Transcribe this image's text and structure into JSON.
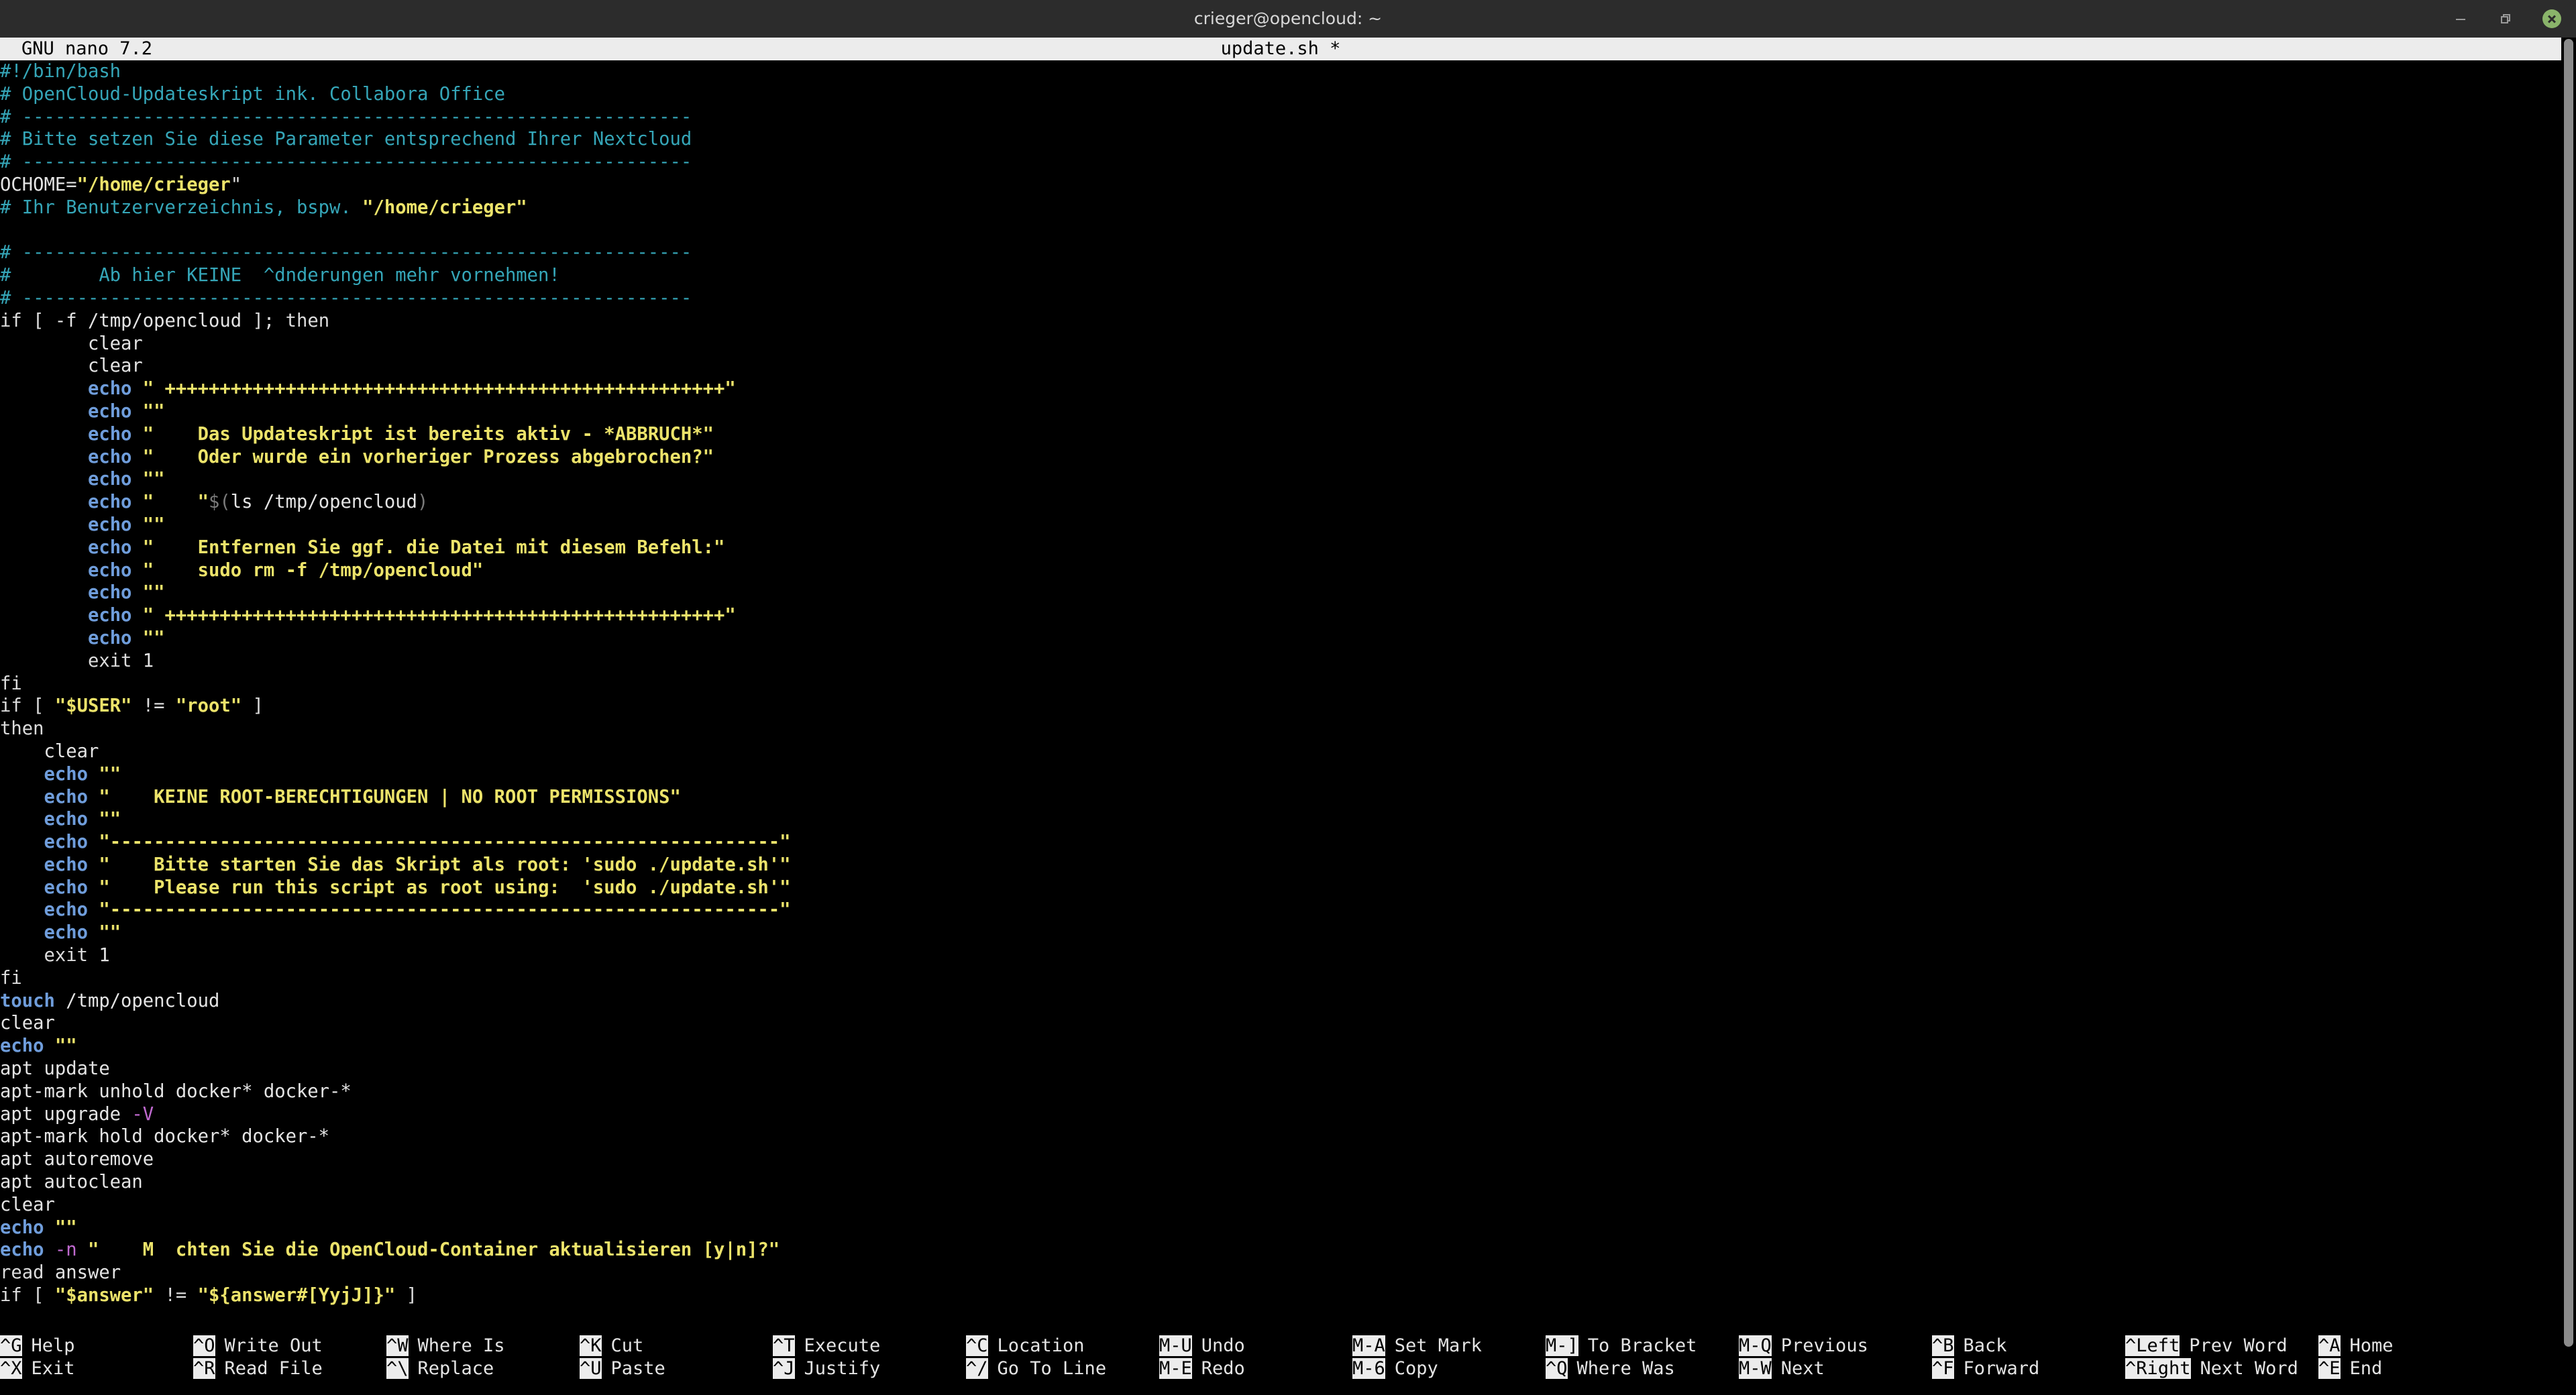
{
  "window": {
    "title": "crieger@opencloud: ~"
  },
  "nano": {
    "version": "GNU nano 7.2",
    "filename": "update.sh *"
  },
  "colors": {
    "header_bg": "#ececec",
    "comment": "#35a6b8",
    "string": "#ece36a",
    "keyword": "#3fa247",
    "command": "#6f9ddb",
    "flag": "#c06ad0",
    "trailing_whitespace": "#4e9a06",
    "close_button": "#8ab46a"
  },
  "lines": [
    [
      {
        "t": "#!/bin/bash",
        "c": "comment"
      }
    ],
    [
      {
        "t": "# OpenCloud-Updateskript ink. Collabora Office",
        "c": "comment"
      }
    ],
    [
      {
        "t": "# -------------------------------------------------------------",
        "c": "comment"
      }
    ],
    [
      {
        "t": "# Bitte setzen Sie diese Parameter entsprechend Ihrer Nextcloud",
        "c": "comment"
      }
    ],
    [
      {
        "t": "# -------------------------------------------------------------",
        "c": "comment"
      }
    ],
    [
      {
        "t": "OCHOME",
        "c": "plain"
      },
      {
        "t": "=",
        "c": "keyword"
      },
      {
        "t": "\"/home/crieger",
        "c": "str"
      },
      {
        "t": "\"",
        "c": "cursor"
      }
    ],
    [
      {
        "t": "# Ihr Benutzerverzeichnis, bspw. ",
        "c": "comment"
      },
      {
        "t": "\"/home/crieger\"",
        "c": "str"
      }
    ],
    [
      {
        "t": "",
        "c": "plain"
      }
    ],
    [
      {
        "t": "# -------------------------------------------------------------",
        "c": "comment"
      }
    ],
    [
      {
        "t": "#        Ab hier KEINE  ^dnderungen mehr vornehmen!",
        "c": "comment"
      }
    ],
    [
      {
        "t": "# -------------------------------------------------------------",
        "c": "comment"
      }
    ],
    [
      {
        "t": "if [ ",
        "c": "keyword"
      },
      {
        "t": "-f",
        "c": "plain"
      },
      {
        "t": " /tmp/opencloud ",
        "c": "plain"
      },
      {
        "t": "]; then",
        "c": "keyword"
      }
    ],
    [
      {
        "t": "        clear",
        "c": "plain"
      }
    ],
    [
      {
        "t": "        clear",
        "c": "plain"
      }
    ],
    [
      {
        "t": "        ",
        "c": "plain"
      },
      {
        "t": "echo",
        "c": "cmd"
      },
      {
        "t": " \" +++++++++++++++++++++++++++++++++++++++++++++++++++\"",
        "c": "str"
      }
    ],
    [
      {
        "t": "        ",
        "c": "plain"
      },
      {
        "t": "echo",
        "c": "cmd"
      },
      {
        "t": " \"\"",
        "c": "str"
      }
    ],
    [
      {
        "t": "        ",
        "c": "plain"
      },
      {
        "t": "echo",
        "c": "cmd"
      },
      {
        "t": " \"    Das Updateskript ist bereits aktiv - *ABBRUCH*\"",
        "c": "str"
      }
    ],
    [
      {
        "t": "        ",
        "c": "plain"
      },
      {
        "t": "echo",
        "c": "cmd"
      },
      {
        "t": " \"    Oder wurde ein vorheriger Prozess abgebrochen?\"",
        "c": "str"
      }
    ],
    [
      {
        "t": "        ",
        "c": "plain"
      },
      {
        "t": "echo",
        "c": "cmd"
      },
      {
        "t": " \"\"",
        "c": "str"
      }
    ],
    [
      {
        "t": "        ",
        "c": "plain"
      },
      {
        "t": "echo",
        "c": "cmd"
      },
      {
        "t": " \"    \"",
        "c": "str"
      },
      {
        "t": "$(",
        "c": "sub"
      },
      {
        "t": "ls /tmp/opencloud",
        "c": "plain"
      },
      {
        "t": ")",
        "c": "sub"
      }
    ],
    [
      {
        "t": "        ",
        "c": "plain"
      },
      {
        "t": "echo",
        "c": "cmd"
      },
      {
        "t": " \"\"",
        "c": "str"
      }
    ],
    [
      {
        "t": "        ",
        "c": "plain"
      },
      {
        "t": "echo",
        "c": "cmd"
      },
      {
        "t": " \"    Entfernen Sie ggf. die Datei mit diesem Befehl:\"",
        "c": "str"
      }
    ],
    [
      {
        "t": "        ",
        "c": "plain"
      },
      {
        "t": "echo",
        "c": "cmd"
      },
      {
        "t": " \"    sudo rm -f /tmp/opencloud\"",
        "c": "str"
      },
      {
        "t": "     ",
        "c": "trail"
      }
    ],
    [
      {
        "t": "        ",
        "c": "plain"
      },
      {
        "t": "echo",
        "c": "cmd"
      },
      {
        "t": " \"\"",
        "c": "str"
      }
    ],
    [
      {
        "t": "        ",
        "c": "plain"
      },
      {
        "t": "echo",
        "c": "cmd"
      },
      {
        "t": " \" +++++++++++++++++++++++++++++++++++++++++++++++++++\"",
        "c": "str"
      }
    ],
    [
      {
        "t": "        ",
        "c": "plain"
      },
      {
        "t": "echo",
        "c": "cmd"
      },
      {
        "t": " \"\"",
        "c": "str"
      }
    ],
    [
      {
        "t": "        ",
        "c": "plain"
      },
      {
        "t": "exit",
        "c": "keyword"
      },
      {
        "t": " 1",
        "c": "plain"
      }
    ],
    [
      {
        "t": "fi",
        "c": "keyword"
      }
    ],
    [
      {
        "t": "if [ ",
        "c": "keyword"
      },
      {
        "t": "\"$USER\"",
        "c": "str"
      },
      {
        "t": " != ",
        "c": "keyword"
      },
      {
        "t": "\"root\"",
        "c": "str"
      },
      {
        "t": " ]",
        "c": "keyword"
      }
    ],
    [
      {
        "t": "then",
        "c": "keyword"
      }
    ],
    [
      {
        "t": "    clear",
        "c": "plain"
      }
    ],
    [
      {
        "t": "    ",
        "c": "plain"
      },
      {
        "t": "echo",
        "c": "cmd"
      },
      {
        "t": " \"\"",
        "c": "str"
      }
    ],
    [
      {
        "t": "    ",
        "c": "plain"
      },
      {
        "t": "echo",
        "c": "cmd"
      },
      {
        "t": " \"    KEINE ROOT-BERECHTIGUNGEN | NO ROOT PERMISSIONS\"",
        "c": "str"
      }
    ],
    [
      {
        "t": "    ",
        "c": "plain"
      },
      {
        "t": "echo",
        "c": "cmd"
      },
      {
        "t": " \"\"",
        "c": "str"
      }
    ],
    [
      {
        "t": "    ",
        "c": "plain"
      },
      {
        "t": "echo",
        "c": "cmd"
      },
      {
        "t": " \"-------------------------------------------------------------\"",
        "c": "str"
      }
    ],
    [
      {
        "t": "    ",
        "c": "plain"
      },
      {
        "t": "echo",
        "c": "cmd"
      },
      {
        "t": " \"    Bitte starten Sie das Skript als root: 'sudo ./update.sh'\"",
        "c": "str"
      }
    ],
    [
      {
        "t": "    ",
        "c": "plain"
      },
      {
        "t": "echo",
        "c": "cmd"
      },
      {
        "t": " \"    Please run this script as root using:  'sudo ./update.sh'\"",
        "c": "str"
      }
    ],
    [
      {
        "t": "    ",
        "c": "plain"
      },
      {
        "t": "echo",
        "c": "cmd"
      },
      {
        "t": " \"-------------------------------------------------------------\"",
        "c": "str"
      }
    ],
    [
      {
        "t": "    ",
        "c": "plain"
      },
      {
        "t": "echo",
        "c": "cmd"
      },
      {
        "t": " \"\"",
        "c": "str"
      }
    ],
    [
      {
        "t": "    ",
        "c": "plain"
      },
      {
        "t": "exit",
        "c": "keyword"
      },
      {
        "t": " 1",
        "c": "plain"
      }
    ],
    [
      {
        "t": "fi",
        "c": "keyword"
      }
    ],
    [
      {
        "t": "touch",
        "c": "cmd"
      },
      {
        "t": " /tmp/opencloud",
        "c": "plain"
      }
    ],
    [
      {
        "t": "clear",
        "c": "plain"
      }
    ],
    [
      {
        "t": "echo",
        "c": "cmd"
      },
      {
        "t": " \"\"",
        "c": "str"
      }
    ],
    [
      {
        "t": "apt update",
        "c": "plain"
      }
    ],
    [
      {
        "t": "apt-mark unhold docker* docker-*",
        "c": "plain"
      }
    ],
    [
      {
        "t": "apt upgrade ",
        "c": "plain"
      },
      {
        "t": "-V",
        "c": "flag"
      }
    ],
    [
      {
        "t": "apt-mark hold docker* docker-*",
        "c": "plain"
      }
    ],
    [
      {
        "t": "apt autoremove",
        "c": "plain"
      }
    ],
    [
      {
        "t": "apt autoclean",
        "c": "plain"
      }
    ],
    [
      {
        "t": "clear",
        "c": "plain"
      }
    ],
    [
      {
        "t": "echo",
        "c": "cmd"
      },
      {
        "t": " \"\"",
        "c": "str"
      }
    ],
    [
      {
        "t": "echo",
        "c": "cmd"
      },
      {
        "t": " -n ",
        "c": "flag"
      },
      {
        "t": "\"    M  chten Sie die OpenCloud-Container aktualisieren [y|n]?\"",
        "c": "str"
      }
    ],
    [
      {
        "t": "read",
        "c": "keyword"
      },
      {
        "t": " answer",
        "c": "plain"
      }
    ],
    [
      {
        "t": "if [ ",
        "c": "keyword"
      },
      {
        "t": "\"$answer\"",
        "c": "str"
      },
      {
        "t": " != ",
        "c": "keyword"
      },
      {
        "t": "\"${answer#[YyjJ]}\"",
        "c": "str"
      },
      {
        "t": " ]",
        "c": "keyword"
      }
    ]
  ],
  "shortcuts": [
    {
      "key": "^G",
      "label": "Help"
    },
    {
      "key": "^X",
      "label": "Exit"
    },
    {
      "key": "^O",
      "label": "Write Out"
    },
    {
      "key": "^R",
      "label": "Read File"
    },
    {
      "key": "^W",
      "label": "Where Is"
    },
    {
      "key": "^\\",
      "label": "Replace"
    },
    {
      "key": "^K",
      "label": "Cut"
    },
    {
      "key": "^U",
      "label": "Paste"
    },
    {
      "key": "^T",
      "label": "Execute"
    },
    {
      "key": "^J",
      "label": "Justify"
    },
    {
      "key": "^C",
      "label": "Location"
    },
    {
      "key": "^/",
      "label": "Go To Line"
    },
    {
      "key": "M-U",
      "label": "Undo"
    },
    {
      "key": "M-E",
      "label": "Redo"
    },
    {
      "key": "M-A",
      "label": "Set Mark"
    },
    {
      "key": "M-6",
      "label": "Copy"
    },
    {
      "key": "M-]",
      "label": "To Bracket"
    },
    {
      "key": "^Q",
      "label": "Where Was"
    },
    {
      "key": "M-Q",
      "label": "Previous"
    },
    {
      "key": "M-W",
      "label": "Next"
    },
    {
      "key": "^B",
      "label": "Back"
    },
    {
      "key": "^F",
      "label": "Forward"
    },
    {
      "key": "^Left",
      "label": "Prev Word"
    },
    {
      "key": "^Right",
      "label": "Next Word"
    },
    {
      "key": "^A",
      "label": "Home"
    },
    {
      "key": "^E",
      "label": "End"
    }
  ]
}
